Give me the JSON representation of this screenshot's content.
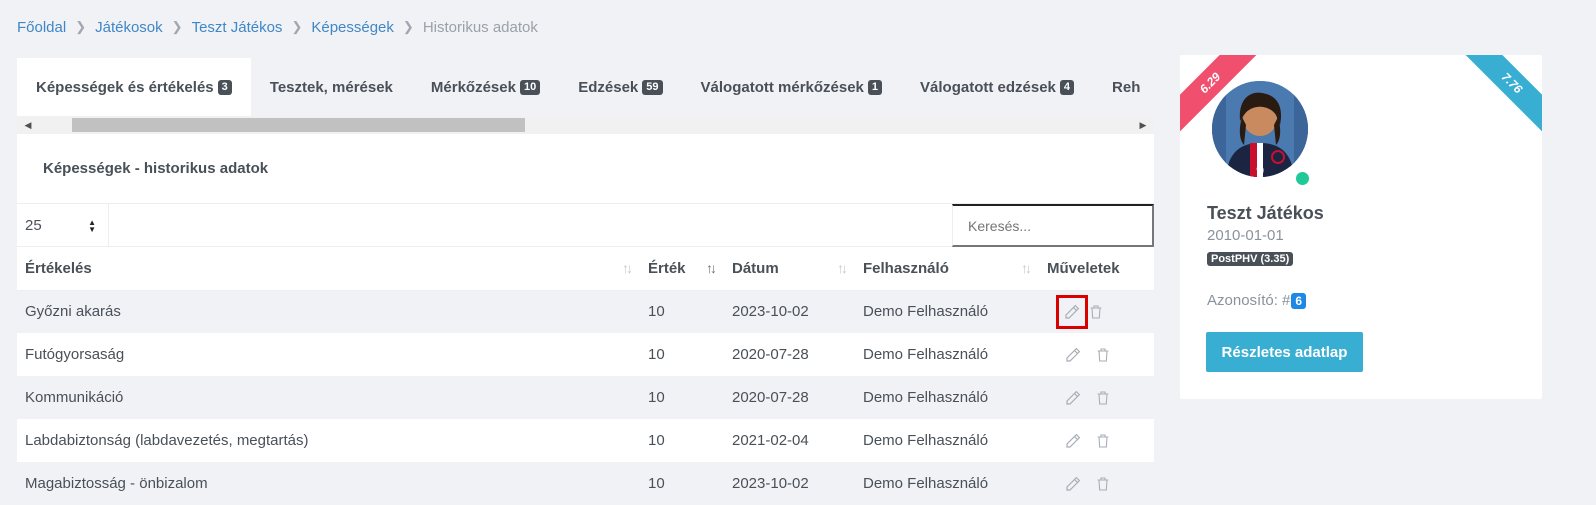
{
  "breadcrumb": {
    "items": [
      "Főoldal",
      "Játékosok",
      "Teszt Játékos",
      "Képességek"
    ],
    "current": "Historikus adatok"
  },
  "tabs": [
    {
      "label": "Képességek és értékelés",
      "badge": "3"
    },
    {
      "label": "Tesztek, mérések",
      "badge": ""
    },
    {
      "label": "Mérkőzések",
      "badge": "10"
    },
    {
      "label": "Edzések",
      "badge": "59"
    },
    {
      "label": "Válogatott mérkőzések",
      "badge": "1"
    },
    {
      "label": "Válogatott edzések",
      "badge": "4"
    },
    {
      "label": "Reh",
      "badge": ""
    }
  ],
  "card": {
    "title": "Képességek - historikus adatok"
  },
  "page_size": "25",
  "search": {
    "placeholder": "Keresés..."
  },
  "table": {
    "headers": [
      "Értékelés",
      "Érték",
      "Dátum",
      "Felhasználó",
      "Műveletek"
    ],
    "rows": [
      [
        "Győzni akarás",
        "10",
        "2023-10-02",
        "Demo Felhasználó"
      ],
      [
        "Futógyorsaság",
        "10",
        "2020-07-28",
        "Demo Felhasználó"
      ],
      [
        "Kommunikáció",
        "10",
        "2020-07-28",
        "Demo Felhasználó"
      ],
      [
        "Labdabiztonság (labdavezetés, megtartás)",
        "10",
        "2021-02-04",
        "Demo Felhasználó"
      ],
      [
        "Magabiztosság - önbizalom",
        "10",
        "2023-10-02",
        "Demo Felhasználó"
      ]
    ]
  },
  "player": {
    "rating_left": "6.29",
    "rating_right": "7.76",
    "name": "Teszt Játékos",
    "dob": "2010-01-01",
    "tag": "PostPHV (3.35)",
    "id_label": "Azonosító: #",
    "id_value": "6",
    "detail_button": "Részletes adatlap"
  },
  "colors": {
    "link": "#3f87c5",
    "ribbon_left": "#f0506e",
    "ribbon_right": "#39aed3",
    "primary_button": "#39aed3",
    "online": "#20c997",
    "highlight": "#d90000"
  }
}
